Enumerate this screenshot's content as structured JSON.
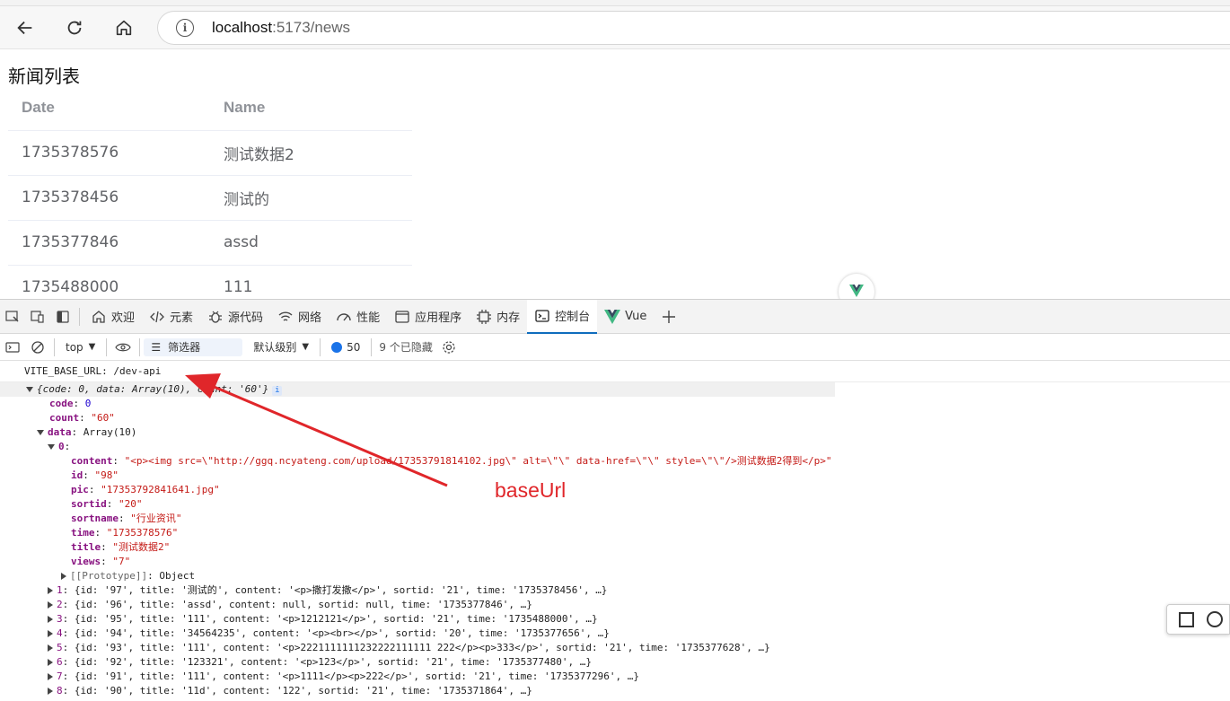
{
  "browser": {
    "url_host": "localhost",
    "url_rest": ":5173/news"
  },
  "page": {
    "title": "新闻列表",
    "table": {
      "headers": [
        "Date",
        "Name"
      ],
      "rows": [
        [
          "1735378576",
          "测试数据2"
        ],
        [
          "1735378456",
          "测试的"
        ],
        [
          "1735377846",
          "assd"
        ],
        [
          "1735488000",
          "111"
        ]
      ]
    }
  },
  "devtools": {
    "tabs": [
      {
        "label": "欢迎",
        "icon": "home-icon"
      },
      {
        "label": "元素",
        "icon": "code-icon"
      },
      {
        "label": "源代码",
        "icon": "bug-icon"
      },
      {
        "label": "网络",
        "icon": "wifi-icon"
      },
      {
        "label": "性能",
        "icon": "performance-icon"
      },
      {
        "label": "应用程序",
        "icon": "application-icon"
      },
      {
        "label": "内存",
        "icon": "memory-icon"
      },
      {
        "label": "控制台",
        "icon": "console-icon",
        "active": true
      },
      {
        "label": "Vue",
        "icon": "vue-icon"
      }
    ],
    "toolbar": {
      "context": "top",
      "filter_label": "筛选器",
      "level": "默认级别",
      "message_count": "50",
      "hidden_count": "9 个已隐藏"
    }
  },
  "console": {
    "lines": [
      {
        "type": "log",
        "text": "VITE_BASE_URL: /dev-api"
      },
      {
        "type": "obj",
        "indent": 0,
        "tri": "down",
        "text": "{code: 0, data: Array(10), count: '60'}"
      },
      {
        "type": "kv",
        "indent": 1,
        "key": "code",
        "val": "0",
        "vclass": "num"
      },
      {
        "type": "kv",
        "indent": 1,
        "key": "count",
        "val": "\"60\"",
        "vclass": "str"
      },
      {
        "type": "kv",
        "indent": 1,
        "tri": "down",
        "key": "data",
        "val": "Array(10)",
        "vclass": ""
      },
      {
        "type": "kv",
        "indent": 2,
        "tri": "down",
        "key": "0",
        "val": "",
        "vclass": ""
      },
      {
        "type": "kv",
        "indent": 3,
        "key": "content",
        "val": "\"<p><img src=\\\"http://ggq.ncyateng.com/upload/17353791814102.jpg\\\" alt=\\\"\\\" data-href=\\\"\\\" style=\\\"\\\"/>测试数据2得到</p>\"",
        "vclass": "str"
      },
      {
        "type": "kv",
        "indent": 3,
        "key": "id",
        "val": "\"98\"",
        "vclass": "str"
      },
      {
        "type": "kv",
        "indent": 3,
        "key": "pic",
        "val": "\"17353792841641.jpg\"",
        "vclass": "str"
      },
      {
        "type": "kv",
        "indent": 3,
        "key": "sortid",
        "val": "\"20\"",
        "vclass": "str"
      },
      {
        "type": "kv",
        "indent": 3,
        "key": "sortname",
        "val": "\"行业资讯\"",
        "vclass": "str"
      },
      {
        "type": "kv",
        "indent": 3,
        "key": "time",
        "val": "\"1735378576\"",
        "vclass": "str"
      },
      {
        "type": "kv",
        "indent": 3,
        "key": "title",
        "val": "\"测试数据2\"",
        "vclass": "str"
      },
      {
        "type": "kv",
        "indent": 3,
        "key": "views",
        "val": "\"7\"",
        "vclass": "str"
      },
      {
        "type": "proto",
        "indent": 3,
        "tri": "right",
        "key": "[[Prototype]]",
        "val": "Object"
      },
      {
        "type": "row",
        "indent": 2,
        "tri": "right",
        "key": "1",
        "val": "{id: '97', title: '测试的', content: '<p>撒打发撒</p>', sortid: '21', time: '1735378456', …}"
      },
      {
        "type": "row",
        "indent": 2,
        "tri": "right",
        "key": "2",
        "val": "{id: '96', title: 'assd', content: null, sortid: null, time: '1735377846', …}"
      },
      {
        "type": "row",
        "indent": 2,
        "tri": "right",
        "key": "3",
        "val": "{id: '95', title: '111', content: '<p>1212121</p>', sortid: '21', time: '1735488000', …}"
      },
      {
        "type": "row",
        "indent": 2,
        "tri": "right",
        "key": "4",
        "val": "{id: '94', title: '34564235', content: '<p><br></p>', sortid: '20', time: '1735377656', …}"
      },
      {
        "type": "row",
        "indent": 2,
        "tri": "right",
        "key": "5",
        "val": "{id: '93', title: '111', content: '<p>2221111111232222111111 222</p><p>333</p>', sortid: '21', time: '1735377628', …}"
      },
      {
        "type": "row",
        "indent": 2,
        "tri": "right",
        "key": "6",
        "val": "{id: '92', title: '123321', content: '<p>123</p>', sortid: '21', time: '1735377480', …}"
      },
      {
        "type": "row",
        "indent": 2,
        "tri": "right",
        "key": "7",
        "val": "{id: '91', title: '111', content: '<p>1111</p><p>222</p>', sortid: '21', time: '1735377296', …}"
      },
      {
        "type": "row",
        "indent": 2,
        "tri": "right",
        "key": "8",
        "val": "{id: '90', title: '11d', content: '122', sortid: '21', time: '1735371864', …}"
      }
    ]
  },
  "annotation": {
    "label": "baseUrl",
    "color": "#e0262a"
  }
}
